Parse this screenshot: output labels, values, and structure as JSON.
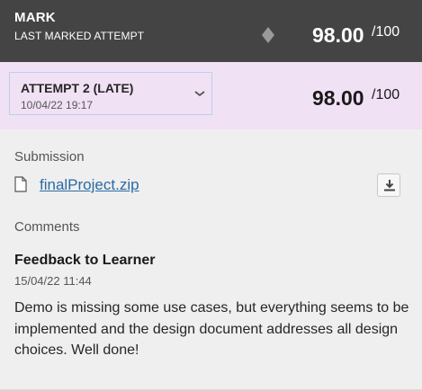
{
  "mark": {
    "title": "MARK",
    "subtitle": "LAST MARKED ATTEMPT",
    "score": "98.00",
    "max": "/100"
  },
  "attempt": {
    "name": "ATTEMPT 2 (LATE)",
    "date": "10/04/22 19:17",
    "score": "98.00",
    "max": "/100"
  },
  "submission": {
    "label": "Submission",
    "file_name": "finalProject.zip"
  },
  "comments": {
    "label": "Comments",
    "title": "Feedback to Learner",
    "date": "15/04/22 11:44",
    "text": "Demo is missing some use cases, but everything seems to be implemented and the design document addresses all design choices. Well done!"
  },
  "icons": {
    "diamond": "diamond-icon",
    "chevron": "chevron-down-icon",
    "file": "file-icon",
    "download": "download-icon"
  },
  "colors": {
    "header_bg": "#444444",
    "attempt_bg": "#f1e1f5",
    "link": "#2a6aa3",
    "page_bg": "#efefef"
  }
}
